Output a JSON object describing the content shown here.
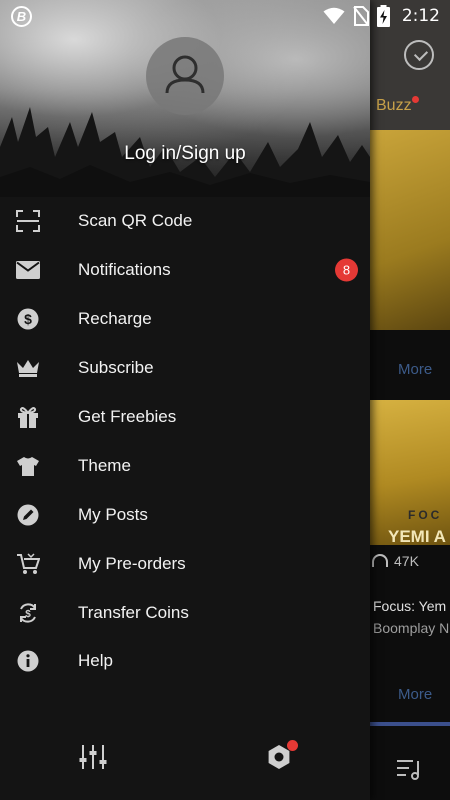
{
  "status_bar": {
    "time": "2:12"
  },
  "background": {
    "tab_label": "Buzz",
    "more_label_1": "More",
    "banner_text_1": "FOC",
    "banner_text_2": "YEMI A",
    "play_count": "47K",
    "caption_title": "Focus: Yem",
    "caption_subtitle": "Boomplay N",
    "more_label_2": "More"
  },
  "drawer": {
    "login_label": "Log in/Sign up",
    "menu": [
      {
        "id": "scan-qr-code",
        "icon": "scan-qr-icon",
        "label": "Scan QR Code"
      },
      {
        "id": "notifications",
        "icon": "envelope-icon",
        "label": "Notifications",
        "badge": "8"
      },
      {
        "id": "recharge",
        "icon": "dollar-coin-icon",
        "label": "Recharge"
      },
      {
        "id": "subscribe",
        "icon": "crown-icon",
        "label": "Subscribe"
      },
      {
        "id": "get-freebies",
        "icon": "gift-icon",
        "label": "Get Freebies"
      },
      {
        "id": "theme",
        "icon": "tshirt-icon",
        "label": "Theme"
      },
      {
        "id": "my-posts",
        "icon": "pencil-circle-icon",
        "label": "My Posts"
      },
      {
        "id": "my-pre-orders",
        "icon": "cart-icon",
        "label": "My Pre-orders"
      },
      {
        "id": "transfer-coins",
        "icon": "transfer-coin-icon",
        "label": "Transfer Coins"
      },
      {
        "id": "help",
        "icon": "info-icon",
        "label": "Help"
      }
    ],
    "footer": {
      "equalizer_icon": "equalizer-icon",
      "settings_icon": "settings-gear-icon",
      "settings_has_dot": true
    }
  },
  "colors": {
    "drawer_bg": "#141414",
    "badge": "#e53935",
    "text": "#f2f2f2",
    "icon": "#cfcfcf"
  }
}
